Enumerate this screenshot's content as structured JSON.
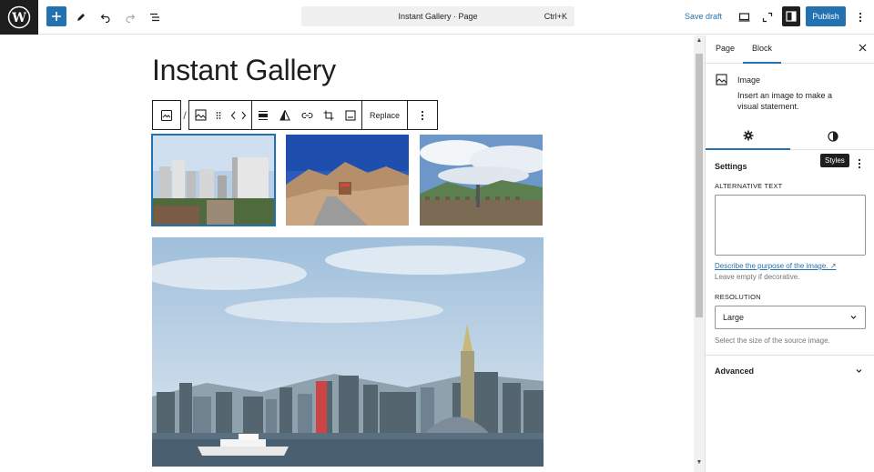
{
  "topbar": {
    "command_label": "Instant Gallery · Page",
    "command_shortcut": "Ctrl+K",
    "save_draft": "Save draft",
    "publish": "Publish"
  },
  "editor": {
    "post_title": "Instant Gallery",
    "toolbar": {
      "replace": "Replace",
      "separator": "/"
    }
  },
  "sidebar": {
    "tabs": [
      {
        "label": "Page"
      },
      {
        "label": "Block"
      }
    ],
    "active_tab": "Block",
    "block": {
      "name": "Image",
      "description": "Insert an image to make a visual statement."
    },
    "tooltip": "Styles",
    "settings_title": "Settings",
    "alt_text_label": "ALTERNATIVE TEXT",
    "alt_text_value": "",
    "describe_link": "Describe the purpose of the image.",
    "describe_help": "Leave empty if decorative.",
    "resolution_label": "RESOLUTION",
    "resolution_value": "Large",
    "resolution_help": "Select the size of the source image.",
    "advanced": "Advanced"
  },
  "colors": {
    "accent": "#2271b1",
    "dark": "#1e1e1e"
  }
}
